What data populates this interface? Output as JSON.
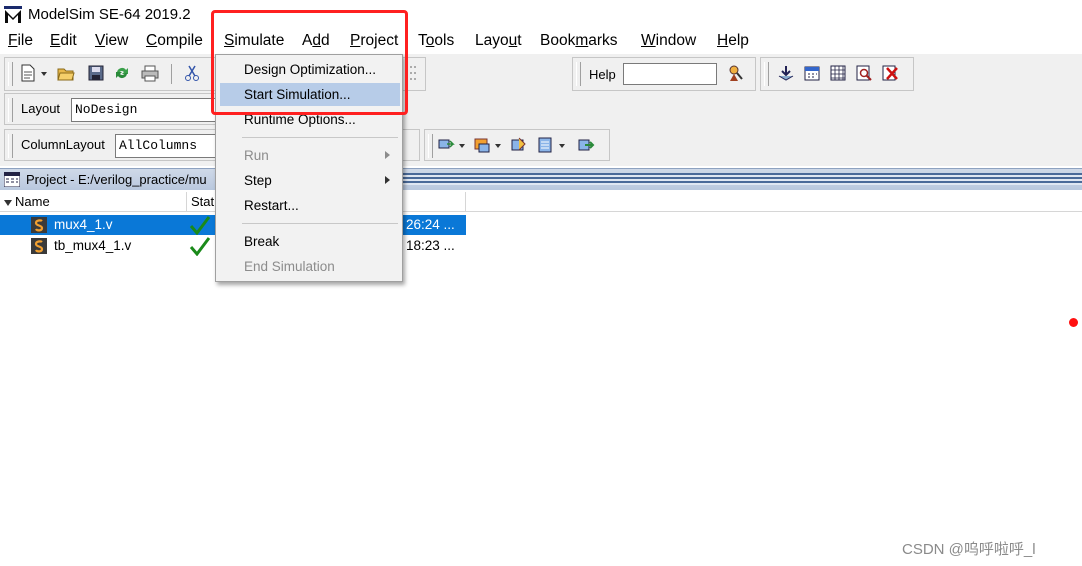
{
  "window": {
    "title": "ModelSim SE-64 2019.2"
  },
  "menubar": {
    "items": [
      {
        "mnemonic": "F",
        "rest": "ile"
      },
      {
        "mnemonic": "E",
        "rest": "dit"
      },
      {
        "mnemonic": "V",
        "rest": "iew"
      },
      {
        "pre": "C",
        "mnemonic": "",
        "rest": "ompile"
      },
      {
        "mnemonic": "S",
        "rest": "imulate"
      },
      {
        "pre": "A",
        "mnemonic": "d",
        "rest": "d"
      },
      {
        "mnemonic": "P",
        "rest": "roject"
      },
      {
        "pre": "T",
        "mnemonic": "o",
        "rest": "ols"
      },
      {
        "pre": "Layo",
        "mnemonic": "u",
        "rest": "t"
      },
      {
        "pre": "Book",
        "mnemonic": "m",
        "rest": "arks"
      },
      {
        "mnemonic": "W",
        "rest": "indow"
      },
      {
        "mnemonic": "H",
        "rest": "elp"
      }
    ]
  },
  "toolbar": {
    "help_label": "Help",
    "layout_label": "Layout",
    "layout_value": "NoDesign",
    "columnlayout_label": "ColumnLayout",
    "columnlayout_value": "AllColumns"
  },
  "simulate_menu": {
    "items": [
      {
        "label": "Design Optimization...",
        "state": "normal"
      },
      {
        "label": "Start Simulation...",
        "state": "highlighted"
      },
      {
        "label": "Runtime Options...",
        "state": "normal"
      },
      {
        "label": "Run",
        "state": "disabled",
        "submenu": true
      },
      {
        "label": "Step",
        "state": "normal",
        "submenu": true
      },
      {
        "label": "Restart...",
        "state": "normal"
      },
      {
        "label": "Break",
        "state": "normal"
      },
      {
        "label": "End Simulation",
        "state": "disabled"
      }
    ]
  },
  "project_panel": {
    "title": "Project - E:/verilog_practice/mu",
    "columns": [
      "Name",
      "Stat"
    ],
    "files": [
      {
        "name": "mux4_1.v",
        "date": "26:24 ...",
        "selected": true
      },
      {
        "name": "tb_mux4_1.v",
        "date": "18:23 ...",
        "selected": false
      }
    ]
  },
  "colors": {
    "selection": "#0a78d7",
    "menu_highlight": "#b7cce8",
    "annotation": "#ff2020"
  },
  "watermark": "CSDN @呜呼啦呼_l"
}
